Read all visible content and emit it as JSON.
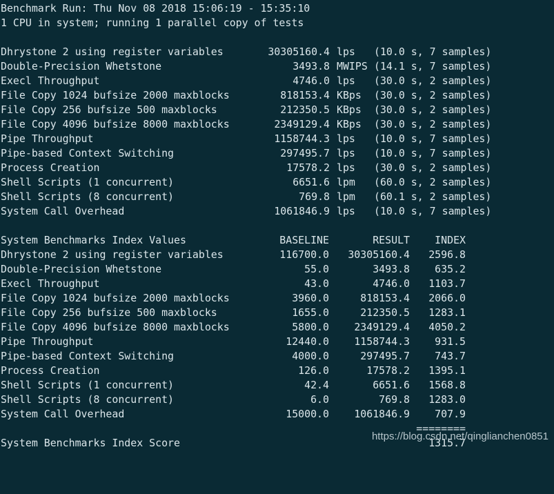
{
  "header": {
    "run_line": "Benchmark Run: Thu Nov 08 2018 15:06:19 - 15:35:10",
    "cpu_line": "1 CPU in system; running 1 parallel copy of tests"
  },
  "results": [
    {
      "name": "Dhrystone 2 using register variables",
      "value": "30305160.4",
      "unit": "lps",
      "detail": "(10.0 s, 7 samples)"
    },
    {
      "name": "Double-Precision Whetstone",
      "value": "3493.8",
      "unit": "MWIPS",
      "detail": "(14.1 s, 7 samples)"
    },
    {
      "name": "Execl Throughput",
      "value": "4746.0",
      "unit": "lps",
      "detail": "(30.0 s, 2 samples)"
    },
    {
      "name": "File Copy 1024 bufsize 2000 maxblocks",
      "value": "818153.4",
      "unit": "KBps",
      "detail": "(30.0 s, 2 samples)"
    },
    {
      "name": "File Copy 256 bufsize 500 maxblocks",
      "value": "212350.5",
      "unit": "KBps",
      "detail": "(30.0 s, 2 samples)"
    },
    {
      "name": "File Copy 4096 bufsize 8000 maxblocks",
      "value": "2349129.4",
      "unit": "KBps",
      "detail": "(30.0 s, 2 samples)"
    },
    {
      "name": "Pipe Throughput",
      "value": "1158744.3",
      "unit": "lps",
      "detail": "(10.0 s, 7 samples)"
    },
    {
      "name": "Pipe-based Context Switching",
      "value": "297495.7",
      "unit": "lps",
      "detail": "(10.0 s, 7 samples)"
    },
    {
      "name": "Process Creation",
      "value": "17578.2",
      "unit": "lps",
      "detail": "(30.0 s, 2 samples)"
    },
    {
      "name": "Shell Scripts (1 concurrent)",
      "value": "6651.6",
      "unit": "lpm",
      "detail": "(60.0 s, 2 samples)"
    },
    {
      "name": "Shell Scripts (8 concurrent)",
      "value": "769.8",
      "unit": "lpm",
      "detail": "(60.1 s, 2 samples)"
    },
    {
      "name": "System Call Overhead",
      "value": "1061846.9",
      "unit": "lps",
      "detail": "(10.0 s, 7 samples)"
    }
  ],
  "index_table": {
    "title": "System Benchmarks Index Values",
    "col_baseline": "BASELINE",
    "col_result": "RESULT",
    "col_index": "INDEX",
    "rows": [
      {
        "name": "Dhrystone 2 using register variables",
        "baseline": "116700.0",
        "result": "30305160.4",
        "index": "2596.8"
      },
      {
        "name": "Double-Precision Whetstone",
        "baseline": "55.0",
        "result": "3493.8",
        "index": "635.2"
      },
      {
        "name": "Execl Throughput",
        "baseline": "43.0",
        "result": "4746.0",
        "index": "1103.7"
      },
      {
        "name": "File Copy 1024 bufsize 2000 maxblocks",
        "baseline": "3960.0",
        "result": "818153.4",
        "index": "2066.0"
      },
      {
        "name": "File Copy 256 bufsize 500 maxblocks",
        "baseline": "1655.0",
        "result": "212350.5",
        "index": "1283.1"
      },
      {
        "name": "File Copy 4096 bufsize 8000 maxblocks",
        "baseline": "5800.0",
        "result": "2349129.4",
        "index": "4050.2"
      },
      {
        "name": "Pipe Throughput",
        "baseline": "12440.0",
        "result": "1158744.3",
        "index": "931.5"
      },
      {
        "name": "Pipe-based Context Switching",
        "baseline": "4000.0",
        "result": "297495.7",
        "index": "743.7"
      },
      {
        "name": "Process Creation",
        "baseline": "126.0",
        "result": "17578.2",
        "index": "1395.1"
      },
      {
        "name": "Shell Scripts (1 concurrent)",
        "baseline": "42.4",
        "result": "6651.6",
        "index": "1568.8"
      },
      {
        "name": "Shell Scripts (8 concurrent)",
        "baseline": "6.0",
        "result": "769.8",
        "index": "1283.0"
      },
      {
        "name": "System Call Overhead",
        "baseline": "15000.0",
        "result": "1061846.9",
        "index": "707.9"
      }
    ],
    "separator": "========",
    "score_label": "System Benchmarks Index Score",
    "score_value": "1315.7"
  },
  "watermark": "https://blog.csdn.net/qinglianchen0851",
  "colors": {
    "background": "#0a2a34",
    "text": "#dbe6ea"
  }
}
